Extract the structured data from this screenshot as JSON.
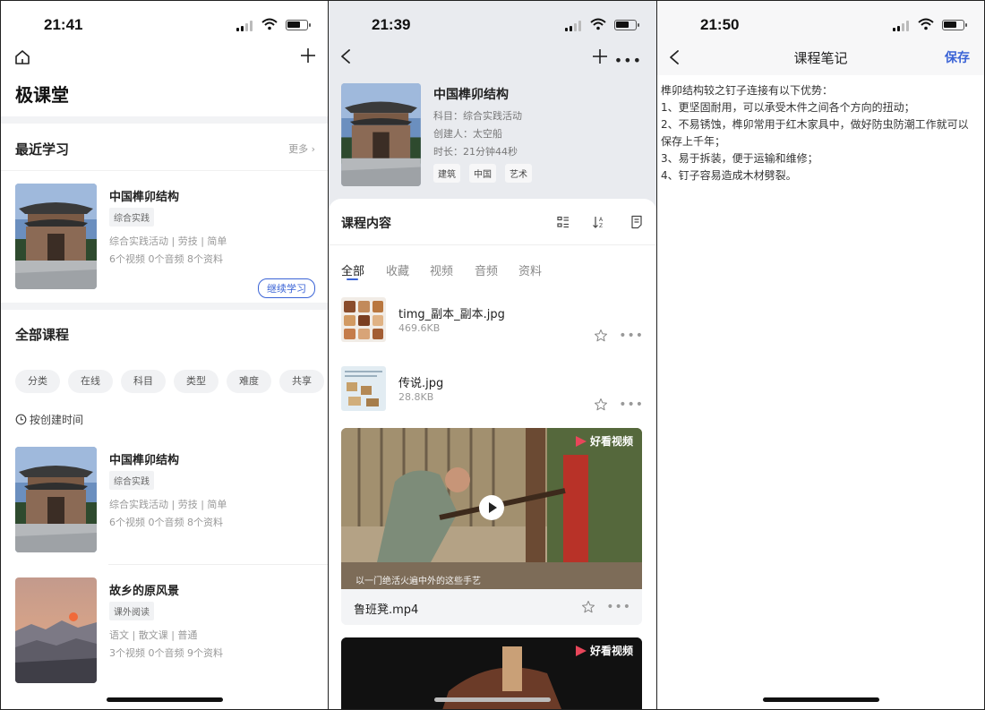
{
  "screen1": {
    "status_time": "21:41",
    "app_title": "极课堂",
    "recent_section": "最近学习",
    "more_label": "更多 ›",
    "recent_course": {
      "title": "中国榫卯结构",
      "tag": "综合实践",
      "meta1": "综合实践活动 | 劳技 | 简单",
      "meta2": "6个视频   0个音频   8个资料",
      "continue_label": "继续学习"
    },
    "all_section": "全部课程",
    "filters": [
      "分类",
      "在线",
      "科目",
      "类型",
      "难度",
      "共享"
    ],
    "sort_label": "按创建时间",
    "courses": [
      {
        "title": "中国榫卯结构",
        "tag": "综合实践",
        "meta1": "综合实践活动 | 劳技 | 简单",
        "meta2": "6个视频   0个音频   8个资料"
      },
      {
        "title": "故乡的原风景",
        "tag": "课外阅读",
        "meta1": "语文 | 散文课 | 普通",
        "meta2": "3个视频   0个音频   9个资料"
      }
    ]
  },
  "screen2": {
    "status_time": "21:39",
    "course_title": "中国榫卯结构",
    "subject_line": "科目：综合实践活动",
    "creator_line": "创建人：太空船",
    "duration_line": "时长：21分钟44秒",
    "tags": [
      "建筑",
      "中国",
      "艺术"
    ],
    "panel_title": "课程内容",
    "tabs": [
      "全部",
      "收藏",
      "视频",
      "音频",
      "资料"
    ],
    "files": [
      {
        "name": "timg_副本_副本.jpg",
        "size": "469.6KB"
      },
      {
        "name": "传说.jpg",
        "size": "28.8KB"
      }
    ],
    "video": {
      "name": "鲁班凳.mp4",
      "watermark": "好看视频",
      "subtitle": "以一门绝活火遍中外的这些手艺"
    },
    "video2_watermark": "好看视频"
  },
  "screen3": {
    "status_time": "21:50",
    "title": "课程笔记",
    "save_label": "保存",
    "note_lines": [
      "榫卯结构较之钉子连接有以下优势：",
      "1、更坚固耐用，可以承受木件之间各个方向的扭动；",
      "2、不易锈蚀，榫卯常用于红木家具中，做好防虫防潮工作就可以保存上千年；",
      "3、易于拆装，便于运输和维修；",
      "4、钉子容易造成木材劈裂。"
    ]
  },
  "colors": {
    "accent": "#3a63d6",
    "muted": "#999999",
    "chip_bg": "#f1f2f4"
  }
}
